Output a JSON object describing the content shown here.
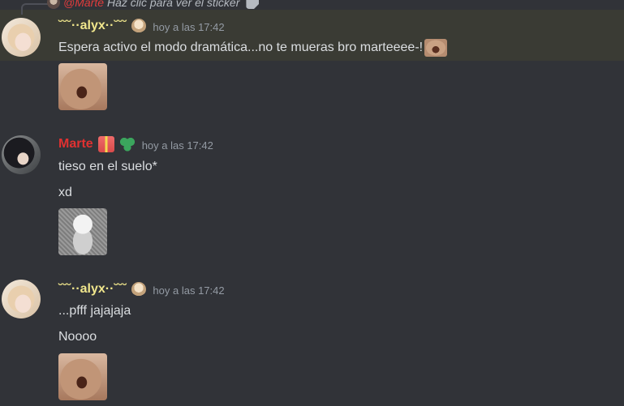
{
  "reply": {
    "name": "@Marte",
    "text": "Haz clic para ver el sticker",
    "icon": "sticker-icon"
  },
  "messages": [
    {
      "username": "˘˘˘··alyx··˘˘˘",
      "timestamp": "hoy a las 17:42",
      "lines": [
        "Espera activo el modo dramática...no te mueras bro marteeee-!"
      ],
      "sticker": "crying-face-sticker"
    },
    {
      "username": "Marte",
      "timestamp": "hoy a las 17:42",
      "lines": [
        "tieso en el suelo*",
        "xd"
      ],
      "sticker": "chibi-sticker"
    },
    {
      "username": "˘˘˘··alyx··˘˘˘",
      "timestamp": "hoy a las 17:42",
      "lines": [
        "...pfff jajajaja",
        "Noooo"
      ],
      "sticker": "crying-face-sticker"
    }
  ],
  "colors": {
    "background": "#313338",
    "highlight": "#3a3b34",
    "alyx_name": "#f0e68c",
    "marte_name": "#e03131",
    "timestamp": "#949ba4",
    "text": "#dbdee1"
  }
}
